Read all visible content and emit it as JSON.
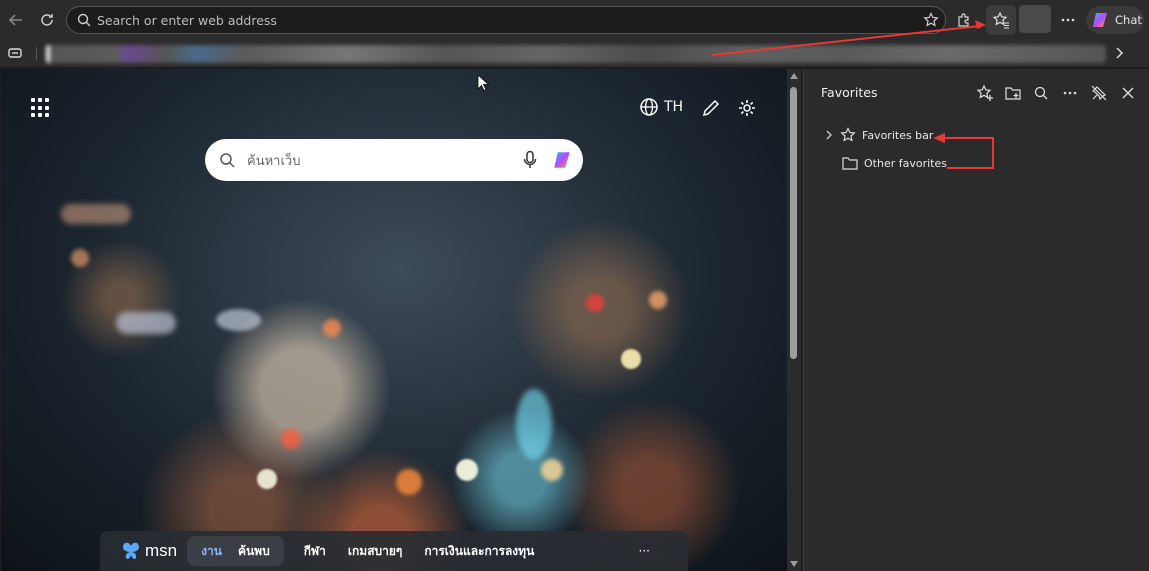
{
  "toolbar": {
    "address_placeholder": "Search or enter web address",
    "chat_label": "Chat"
  },
  "icons": {
    "back": "back-arrow-icon",
    "refresh": "refresh-icon",
    "search": "search-icon",
    "favorite_star": "star-outline-icon",
    "extensions": "puzzle-icon",
    "favorites": "favorites-star-list-icon",
    "more": "ellipsis-icon",
    "copilot": "copilot-icon"
  },
  "new_tab": {
    "search_placeholder": "ค้นหาเว็บ",
    "language": "TH"
  },
  "msn": {
    "logo_text": "msn",
    "pill_tabs": [
      "งาน",
      "ค้นพบ"
    ],
    "links": [
      "กีฬา",
      "เกมสบายๆ",
      "การเงินและการลงทุน"
    ],
    "more": "···"
  },
  "favorites_panel": {
    "title": "Favorites",
    "items": [
      {
        "label": "Favorites bar"
      },
      {
        "label": "Other favorites"
      }
    ]
  },
  "colors": {
    "annotation_red": "#e53935",
    "panel_bg": "#2b2b2b",
    "accent_blue": "#8ab4ff"
  }
}
